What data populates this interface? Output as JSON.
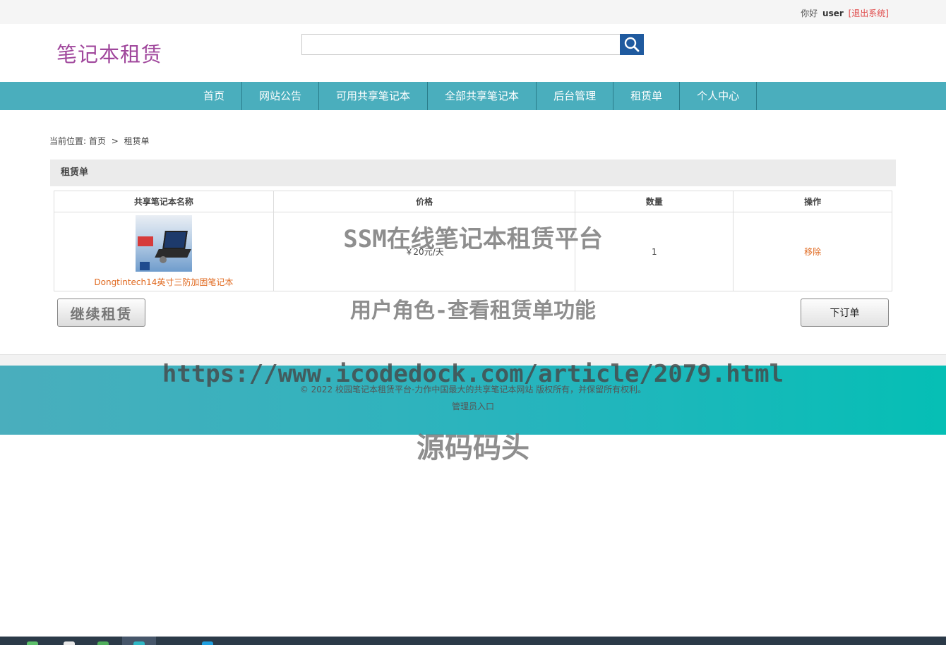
{
  "topbar": {
    "greeting": "你好",
    "username": "user",
    "logout": "[退出系统]"
  },
  "header": {
    "logo": "笔记本租赁",
    "search_placeholder": "",
    "search_icon": "search-icon"
  },
  "nav": {
    "items": [
      {
        "label": "首页"
      },
      {
        "label": "网站公告"
      },
      {
        "label": "可用共享笔记本"
      },
      {
        "label": "全部共享笔记本"
      },
      {
        "label": "后台管理"
      },
      {
        "label": "租赁单"
      },
      {
        "label": "个人中心"
      }
    ]
  },
  "breadcrumb": {
    "prefix": "当前位置:",
    "home": "首页",
    "separator": ">",
    "current": "租赁单"
  },
  "panel": {
    "title": "租赁单"
  },
  "cart": {
    "headers": [
      "共享笔记本名称",
      "价格",
      "数量",
      "操作"
    ],
    "rows": [
      {
        "name": "Dongtintech14英寸三防加固笔记本",
        "price": "￥20元/天",
        "quantity": "1",
        "action": "移除"
      }
    ]
  },
  "buttons": {
    "continue": "继续租赁",
    "order": "下订单"
  },
  "footer": {
    "copyright": "© 2022 校园笔记本租赁平台-力作中国最大的共享笔记本网站 版权所有，并保留所有权利。",
    "admin_entry": "管理员入口"
  },
  "watermarks": {
    "line1": "SSM在线笔记本租赁平台",
    "line2": "用户角色-查看租赁单功能",
    "line3": "https://www.icodedock.com/article/2079.html",
    "line4": "源码码头"
  },
  "colors": {
    "nav_bg": "#4aaebd",
    "logo": "#a0479c",
    "search_button": "#1f5a9f",
    "link_orange": "#e0691f",
    "logout_red": "#e04b4b"
  }
}
